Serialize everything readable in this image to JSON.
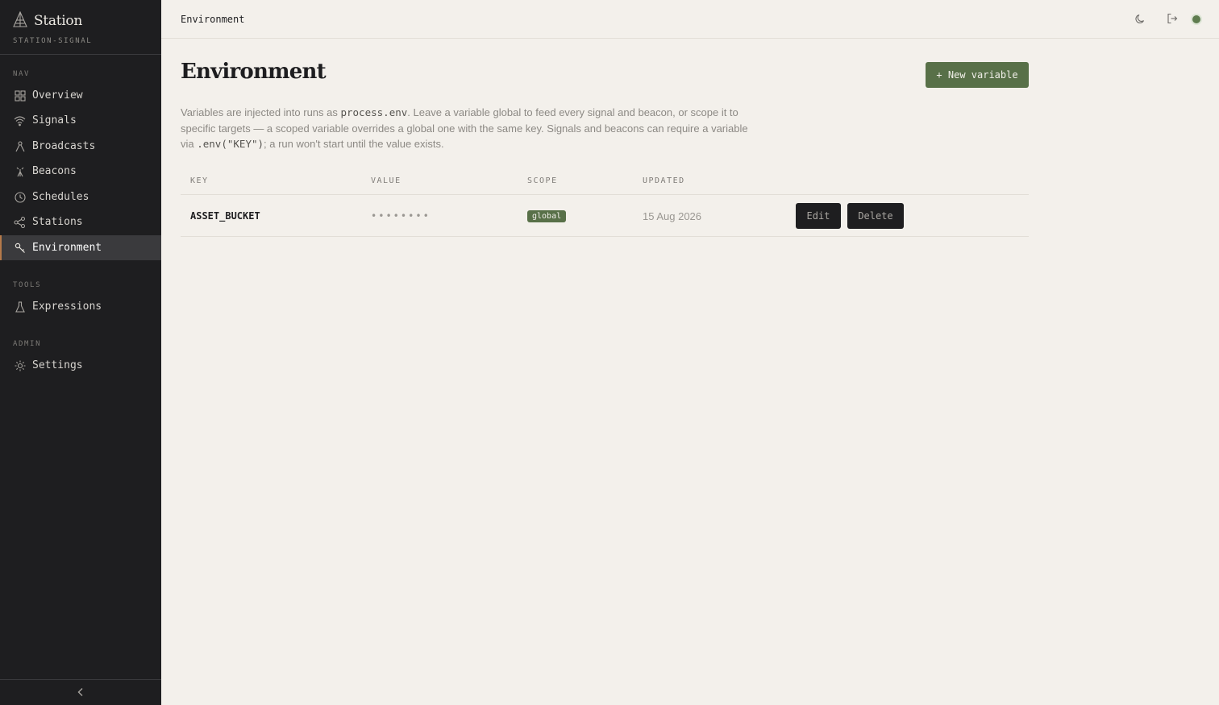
{
  "sidebar": {
    "brand": "Station",
    "workspace": "STATION-SIGNAL",
    "sections": {
      "nav": "NAV",
      "tools": "TOOLS",
      "admin": "ADMIN"
    },
    "nav_items": [
      {
        "label": "Overview",
        "icon": "grid-icon"
      },
      {
        "label": "Signals",
        "icon": "wifi-icon"
      },
      {
        "label": "Broadcasts",
        "icon": "broadcast-icon"
      },
      {
        "label": "Beacons",
        "icon": "beacon-icon"
      },
      {
        "label": "Schedules",
        "icon": "clock-icon"
      },
      {
        "label": "Stations",
        "icon": "share-icon"
      },
      {
        "label": "Environment",
        "icon": "key-icon",
        "active": true
      }
    ],
    "tools_items": [
      {
        "label": "Expressions",
        "icon": "flask-icon"
      }
    ],
    "admin_items": [
      {
        "label": "Settings",
        "icon": "gear-icon"
      }
    ]
  },
  "topbar": {
    "title": "Environment",
    "status_color": "#5f7c4f"
  },
  "main": {
    "title": "Environment",
    "new_button": "+ New variable",
    "description": {
      "p1": "Variables are injected into runs as ",
      "code1": "process.env",
      "p2": ". Leave a variable global to feed every signal and beacon, or scope it to specific targets — a scoped variable overrides a global one with the same key. Signals and beacons can require a variable via ",
      "code2": ".env(\"KEY\")",
      "p3": "; a run won't start until the value exists."
    },
    "table": {
      "headers": {
        "key": "KEY",
        "value": "VALUE",
        "scope": "SCOPE",
        "updated": "UPDATED"
      },
      "rows": [
        {
          "key": "ASSET_BUCKET",
          "value": "••••••••",
          "scope": "global",
          "updated": "15 Aug 2026",
          "edit": "Edit",
          "delete": "Delete"
        }
      ]
    }
  },
  "colors": {
    "accent": "#587048",
    "sidebar_bg": "#1e1e20",
    "page_bg": "#f3f0eb",
    "active_indicator": "#b57a4a"
  }
}
